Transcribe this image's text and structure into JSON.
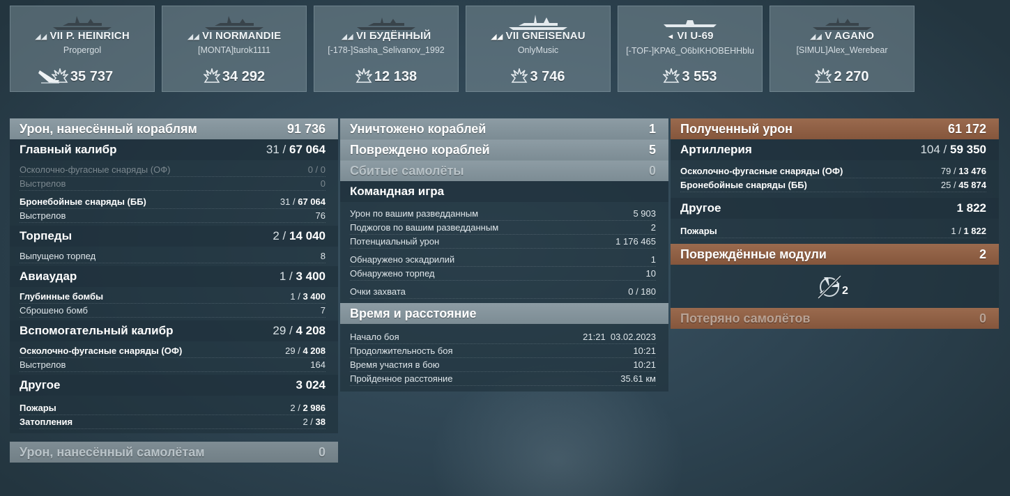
{
  "ships": [
    {
      "tier": "VII",
      "name": "P. HEINRICH",
      "player": "Propergol",
      "damage": "35 737",
      "sunk": true
    },
    {
      "tier": "VI",
      "name": "NORMANDIE",
      "player": "[MONTA]turok1111",
      "damage": "34 292",
      "sunk": false
    },
    {
      "tier": "VI",
      "name": "БУДЁННЫЙ",
      "player": "[-178-]Sasha_Selivanov_1992",
      "damage": "12 138",
      "sunk": false
    },
    {
      "tier": "VII",
      "name": "GNEISENAU",
      "player": "OnlyMusic",
      "damage": "3 746",
      "sunk": false
    },
    {
      "tier": "VI",
      "name": "U-69",
      "player": "[-TOF-]KPA6_O6bIKHOBEHHblu",
      "damage": "3 553",
      "sunk": false
    },
    {
      "tier": "V",
      "name": "AGANO",
      "player": "[SIMUL]Alex_Werebear",
      "damage": "2 270",
      "sunk": false
    }
  ],
  "dealt": {
    "title": "Урон, нанесённый кораблям",
    "total": "91 736",
    "main": {
      "title": "Главный калибр",
      "hits": "31",
      "damage": "67 064",
      "he_label": "Осколочно-фугасные снаряды (ОФ)",
      "he_hits": "0",
      "he_damage": "0",
      "he_shots_label": "Выстрелов",
      "he_shots": "0",
      "ap_label": "Бронебойные снаряды (ББ)",
      "ap_hits": "31",
      "ap_damage": "67 064",
      "ap_shots_label": "Выстрелов",
      "ap_shots": "76"
    },
    "torpedoes": {
      "title": "Торпеды",
      "hits": "2",
      "damage": "14 040",
      "launched_label": "Выпущено торпед",
      "launched": "8"
    },
    "airstrike": {
      "title": "Авиаудар",
      "hits": "1",
      "damage": "3 400",
      "depth_label": "Глубинные бомбы",
      "depth_hits": "1",
      "depth_damage": "3 400",
      "dropped_label": "Сброшено бомб",
      "dropped": "7"
    },
    "secondary": {
      "title": "Вспомогательный калибр",
      "hits": "29",
      "damage": "4 208",
      "he_label": "Осколочно-фугасные снаряды (ОФ)",
      "he_hits": "29",
      "he_damage": "4 208",
      "shots_label": "Выстрелов",
      "shots": "164"
    },
    "other": {
      "title": "Другое",
      "total": "3 024",
      "fires_label": "Пожары",
      "fires_count": "2",
      "fires_damage": "2 986",
      "flood_label": "Затопления",
      "flood_count": "2",
      "flood_damage": "38"
    },
    "aircraft": {
      "title": "Урон, нанесённый самолётам",
      "value": "0"
    }
  },
  "middle": {
    "destroyed_label": "Уничтожено кораблей",
    "destroyed": "1",
    "damaged_label": "Повреждено кораблей",
    "damaged": "5",
    "planes_label": "Сбитые самолёты",
    "planes": "0",
    "team_title": "Командная игра",
    "team": [
      {
        "label": "Урон по вашим разведданным",
        "value": "5 903"
      },
      {
        "label": "Поджогов по вашим разведданным",
        "value": "2"
      },
      {
        "label": "Потенциальный урон",
        "value": "1 176 465"
      },
      {
        "label": "Обнаружено эскадрилий",
        "value": "1"
      },
      {
        "label": "Обнаружено торпед",
        "value": "10"
      },
      {
        "label": "Очки захвата",
        "value": "0 / 180"
      }
    ],
    "time_title": "Время и расстояние",
    "time": [
      {
        "label": "Начало боя",
        "value": "21:21  03.02.2023"
      },
      {
        "label": "Продолжительность боя",
        "value": "10:21"
      },
      {
        "label": "Время участия в бою",
        "value": "10:21"
      },
      {
        "label": "Пройденное расстояние",
        "value": "35.61 км"
      }
    ]
  },
  "received": {
    "title": "Полученный урон",
    "total": "61 172",
    "artillery": {
      "title": "Артиллерия",
      "hits": "104",
      "damage": "59 350",
      "he_label": "Осколочно-фугасные снаряды (ОФ)",
      "he_hits": "79",
      "he_damage": "13 476",
      "ap_label": "Бронебойные снаряды (ББ)",
      "ap_hits": "25",
      "ap_damage": "45 874"
    },
    "other": {
      "title": "Другое",
      "total": "1 822",
      "fires_label": "Пожары",
      "fires_count": "1",
      "fires_damage": "1 822"
    },
    "modules_title": "Повреждённые модули",
    "modules": "2",
    "module_icon": "propeller-icon",
    "module_count": "2",
    "planes_lost_label": "Потеряно самолётов",
    "planes_lost": "0"
  },
  "colors": {
    "header": "#8d9ca4",
    "received_header": "#9a6a4e",
    "panel": "#1e303a"
  }
}
